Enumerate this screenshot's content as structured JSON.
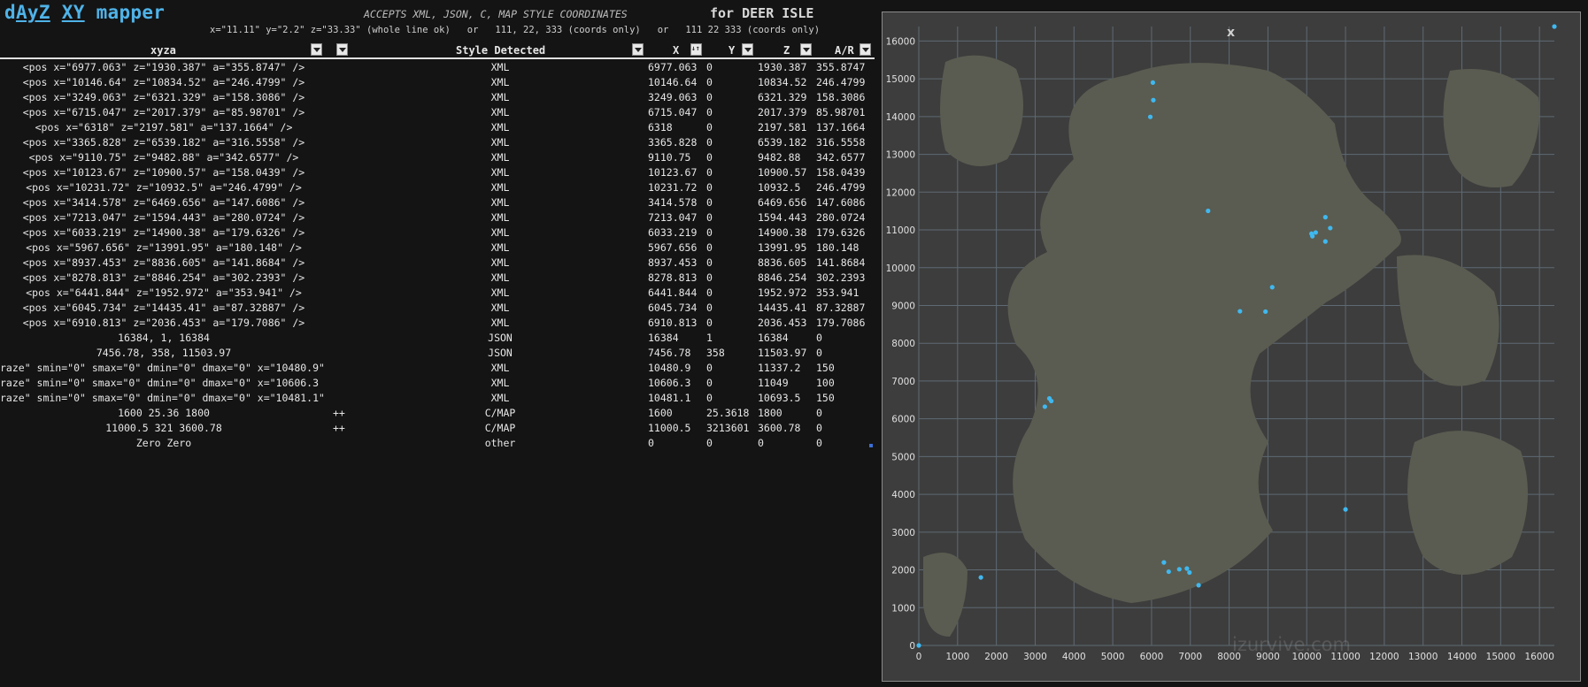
{
  "app": {
    "title_parts": [
      "d",
      "AyZ",
      " ",
      "XY",
      " mapper"
    ],
    "accepts": "ACCEPTS XML, JSON, C, MAP STYLE COORDINATES",
    "for_label": "for DEER ISLE",
    "formats": "x=\"11.11\" y=\"2.2\" z=\"33.33\" (whole line ok)   or   111, 22, 333 (coords only)   or   111 22 333 (coords only)"
  },
  "columns": {
    "xyza": "xyza",
    "style": "Style Detected",
    "x": "X",
    "y": "Y",
    "z": "Z",
    "ar": "A/R"
  },
  "rows": [
    {
      "input": "<pos x=\"6977.063\" z=\"1930.387\" a=\"355.8747\" />",
      "style": "XML",
      "x": "6977.063",
      "y": "0",
      "z": "1930.387",
      "ar": "355.8747"
    },
    {
      "input": "<pos x=\"10146.64\" z=\"10834.52\" a=\"246.4799\" />",
      "style": "XML",
      "x": "10146.64",
      "y": "0",
      "z": "10834.52",
      "ar": "246.4799"
    },
    {
      "input": "<pos x=\"3249.063\" z=\"6321.329\" a=\"158.3086\" />",
      "style": "XML",
      "x": "3249.063",
      "y": "0",
      "z": "6321.329",
      "ar": "158.3086"
    },
    {
      "input": "<pos x=\"6715.047\" z=\"2017.379\" a=\"85.98701\" />",
      "style": "XML",
      "x": "6715.047",
      "y": "0",
      "z": "2017.379",
      "ar": "85.98701"
    },
    {
      "input": "<pos x=\"6318\" z=\"2197.581\" a=\"137.1664\" />",
      "style": "XML",
      "x": "6318",
      "y": "0",
      "z": "2197.581",
      "ar": "137.1664"
    },
    {
      "input": "<pos x=\"3365.828\" z=\"6539.182\" a=\"316.5558\" />",
      "style": "XML",
      "x": "3365.828",
      "y": "0",
      "z": "6539.182",
      "ar": "316.5558"
    },
    {
      "input": "<pos x=\"9110.75\" z=\"9482.88\" a=\"342.6577\" />",
      "style": "XML",
      "x": "9110.75",
      "y": "0",
      "z": "9482.88",
      "ar": "342.6577"
    },
    {
      "input": "<pos x=\"10123.67\" z=\"10900.57\" a=\"158.0439\" />",
      "style": "XML",
      "x": "10123.67",
      "y": "0",
      "z": "10900.57",
      "ar": "158.0439"
    },
    {
      "input": "<pos x=\"10231.72\" z=\"10932.5\" a=\"246.4799\" />",
      "style": "XML",
      "x": "10231.72",
      "y": "0",
      "z": "10932.5",
      "ar": "246.4799"
    },
    {
      "input": "<pos x=\"3414.578\" z=\"6469.656\" a=\"147.6086\" />",
      "style": "XML",
      "x": "3414.578",
      "y": "0",
      "z": "6469.656",
      "ar": "147.6086"
    },
    {
      "input": "<pos x=\"7213.047\" z=\"1594.443\" a=\"280.0724\" />",
      "style": "XML",
      "x": "7213.047",
      "y": "0",
      "z": "1594.443",
      "ar": "280.0724"
    },
    {
      "input": "<pos x=\"6033.219\" z=\"14900.38\" a=\"179.6326\" />",
      "style": "XML",
      "x": "6033.219",
      "y": "0",
      "z": "14900.38",
      "ar": "179.6326"
    },
    {
      "input": "<pos x=\"5967.656\" z=\"13991.95\" a=\"180.148\" />",
      "style": "XML",
      "x": "5967.656",
      "y": "0",
      "z": "13991.95",
      "ar": "180.148"
    },
    {
      "input": "<pos x=\"8937.453\" z=\"8836.605\" a=\"141.8684\" />",
      "style": "XML",
      "x": "8937.453",
      "y": "0",
      "z": "8836.605",
      "ar": "141.8684"
    },
    {
      "input": "<pos x=\"8278.813\" z=\"8846.254\" a=\"302.2393\" />",
      "style": "XML",
      "x": "8278.813",
      "y": "0",
      "z": "8846.254",
      "ar": "302.2393"
    },
    {
      "input": "<pos x=\"6441.844\" z=\"1952.972\" a=\"353.941\" />",
      "style": "XML",
      "x": "6441.844",
      "y": "0",
      "z": "1952.972",
      "ar": "353.941"
    },
    {
      "input": "<pos x=\"6045.734\" z=\"14435.41\" a=\"87.32887\" />",
      "style": "XML",
      "x": "6045.734",
      "y": "0",
      "z": "14435.41",
      "ar": "87.32887"
    },
    {
      "input": "<pos x=\"6910.813\" z=\"2036.453\" a=\"179.7086\" />",
      "style": "XML",
      "x": "6910.813",
      "y": "0",
      "z": "2036.453",
      "ar": "179.7086"
    },
    {
      "input": "16384, 1, 16384",
      "style": "JSON",
      "x": "16384",
      "y": "1",
      "z": "16384",
      "ar": "0"
    },
    {
      "input": "7456.78, 358, 11503.97",
      "style": "JSON",
      "x": "7456.78",
      "y": "358",
      "z": "11503.97",
      "ar": "0"
    },
    {
      "input": "raze\" smin=\"0\" smax=\"0\" dmin=\"0\" dmax=\"0\" x=\"10480.9\"",
      "style": "XML",
      "x": "10480.9",
      "y": "0",
      "z": "11337.2",
      "ar": "150",
      "left": true
    },
    {
      "input": "raze\" smin=\"0\" smax=\"0\" dmin=\"0\" dmax=\"0\" x=\"10606.3",
      "style": "XML",
      "x": "10606.3",
      "y": "0",
      "z": "11049",
      "ar": "100",
      "left": true
    },
    {
      "input": "raze\" smin=\"0\" smax=\"0\" dmin=\"0\" dmax=\"0\" x=\"10481.1\"",
      "style": "XML",
      "x": "10481.1",
      "y": "0",
      "z": "10693.5",
      "ar": "150",
      "left": true
    },
    {
      "input": "1600 25.36 1800",
      "plus": "++",
      "style": "C/MAP",
      "x": "1600",
      "y": "25.3618",
      "z": "1800",
      "ar": "0"
    },
    {
      "input": "11000.5 321 3600.78",
      "plus": "++",
      "style": "C/MAP",
      "x": "11000.5",
      "y": "3213601",
      "z": "3600.78",
      "ar": "0"
    },
    {
      "input": "Zero Zero",
      "style": "other",
      "x": "0",
      "y": "0",
      "z": "0",
      "ar": "0"
    }
  ],
  "chart_data": {
    "type": "scatter",
    "title": "",
    "xlabel": "",
    "ylabel": "",
    "xlim": [
      0,
      16384
    ],
    "ylim": [
      0,
      16384
    ],
    "x_ticks": [
      0,
      1000,
      2000,
      3000,
      4000,
      5000,
      6000,
      7000,
      8000,
      9000,
      10000,
      11000,
      12000,
      13000,
      14000,
      15000,
      16000
    ],
    "y_ticks": [
      0,
      1000,
      2000,
      3000,
      4000,
      5000,
      6000,
      7000,
      8000,
      9000,
      10000,
      11000,
      12000,
      13000,
      14000,
      15000,
      16000
    ],
    "grid": true,
    "background": "DEER ISLE map",
    "point_color": "#3fb8f0",
    "points": [
      [
        6977.063,
        1930.387
      ],
      [
        10146.64,
        10834.52
      ],
      [
        3249.063,
        6321.329
      ],
      [
        6715.047,
        2017.379
      ],
      [
        6318,
        2197.581
      ],
      [
        3365.828,
        6539.182
      ],
      [
        9110.75,
        9482.88
      ],
      [
        10123.67,
        10900.57
      ],
      [
        10231.72,
        10932.5
      ],
      [
        3414.578,
        6469.656
      ],
      [
        7213.047,
        1594.443
      ],
      [
        6033.219,
        14900.38
      ],
      [
        5967.656,
        13991.95
      ],
      [
        8937.453,
        8836.605
      ],
      [
        8278.813,
        8846.254
      ],
      [
        6441.844,
        1952.972
      ],
      [
        6045.734,
        14435.41
      ],
      [
        6910.813,
        2036.453
      ],
      [
        16384,
        16384
      ],
      [
        7456.78,
        11503.97
      ],
      [
        10480.9,
        11337.2
      ],
      [
        10606.3,
        11049
      ],
      [
        10481.1,
        10693.5
      ],
      [
        1600,
        1800
      ],
      [
        11000.5,
        3600.78
      ],
      [
        0,
        0
      ]
    ],
    "close_label": "x",
    "watermark": "izurvive.com"
  }
}
